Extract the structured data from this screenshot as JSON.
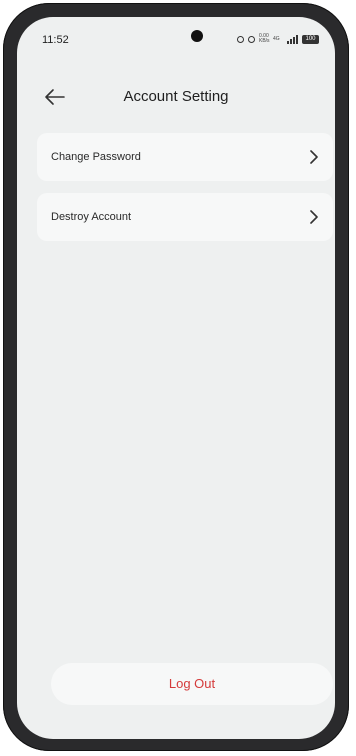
{
  "status_bar": {
    "time": "11:52",
    "network_speed": "0.00 KB/s",
    "network_type": "4G",
    "battery": "100"
  },
  "header": {
    "title": "Account Setting",
    "back_icon": "arrow-left-icon"
  },
  "menu": {
    "items": [
      {
        "label": "Change Password",
        "icon": "chevron-right-icon"
      },
      {
        "label": "Destroy Account",
        "icon": "chevron-right-icon"
      }
    ]
  },
  "logout": {
    "label": "Log Out",
    "color": "#d43a3a"
  }
}
